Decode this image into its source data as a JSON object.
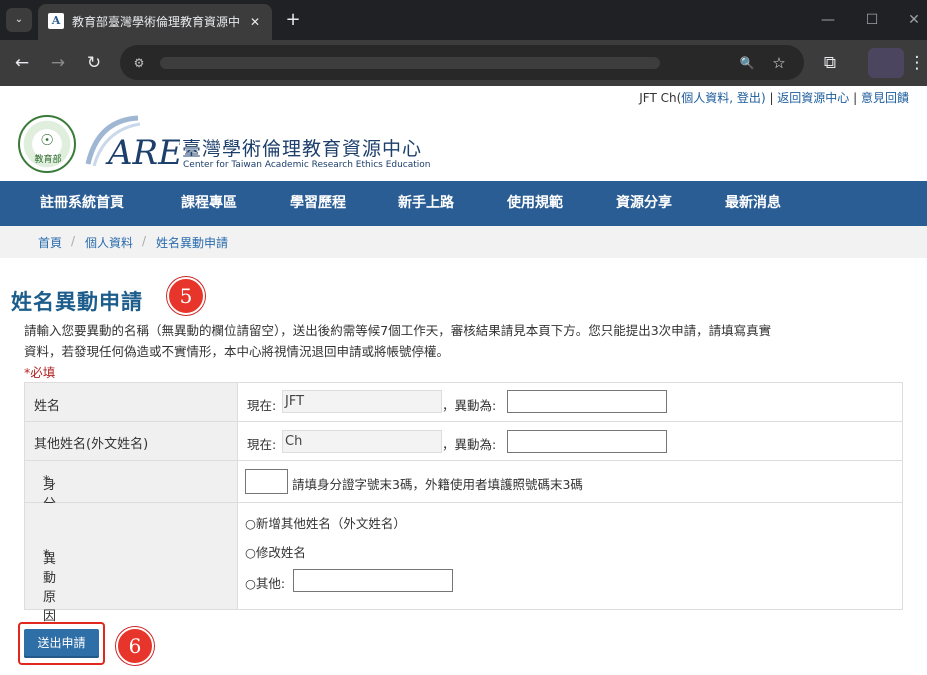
{
  "browser": {
    "tab_title": "教育部臺灣學術倫理教育資源中心",
    "tab_close": "✕",
    "new_tab": "+",
    "tab_list": "⌄",
    "minimize": "—",
    "maximize": "☐",
    "close": "✕",
    "back": "←",
    "forward": "→",
    "reload": "↻",
    "site_info": "⚙",
    "zoom": "🔍",
    "bookmark": "☆",
    "extensions": "⧉",
    "menu": "⋮"
  },
  "userbar": {
    "user": "JFT Ch",
    "open_paren": "(",
    "profile_link": "個人資料",
    "comma": ", ",
    "logout_link": "登出",
    "close_paren": ")",
    "sep1": " | ",
    "home_link": "返回資源中心",
    "sep2": " | ",
    "feedback_link": "意見回饋"
  },
  "header": {
    "moe_text": "教育部",
    "moe_glyph": "☉",
    "site_name_zh": "臺灣學術倫理教育資源中心",
    "site_name_en": "Center for Taiwan Academic Research Ethics Education",
    "logo_text": "AREE"
  },
  "nav": {
    "items": [
      "註冊系統首頁",
      "課程專區",
      "學習歷程",
      "新手上路",
      "使用規範",
      "資源分享",
      "最新消息"
    ]
  },
  "breadcrumb": {
    "items": [
      "首頁",
      "個人資料",
      "姓名異動申請"
    ],
    "separator": "/"
  },
  "page": {
    "title": "姓名異動申請",
    "callout_title": "5",
    "callout_submit": "6",
    "intro_line1": "請輸入您要異動的名稱（無異動的欄位請留空），送出後約需等候7個工作天，審核結果請見本頁下方。您只能提出3次申請，請填寫真實",
    "intro_line2": "資料，若發現任何偽造或不實情形，本中心將視情況退回申請或將帳號停權。",
    "required_note": "*必填"
  },
  "form": {
    "name": {
      "label": "姓名",
      "current_label": "現在:",
      "current_value": "JFT",
      "change_label": "，異動為:"
    },
    "other_name": {
      "label": "其他姓名(外文姓名)",
      "current_label": "現在:",
      "current_value": "Ch",
      "change_label": "，異動為:"
    },
    "verify": {
      "label": "身分驗證碼",
      "required_mark": "*",
      "hint": "請填身分證字號末3碼，外籍使用者填護照號碼末3碼"
    },
    "reason": {
      "label": "異動原因",
      "required_mark": "*",
      "option1": "○新增其他姓名（外文姓名）",
      "option2": "○修改姓名",
      "option3": "○其他:"
    },
    "submit_label": "送出申請"
  }
}
